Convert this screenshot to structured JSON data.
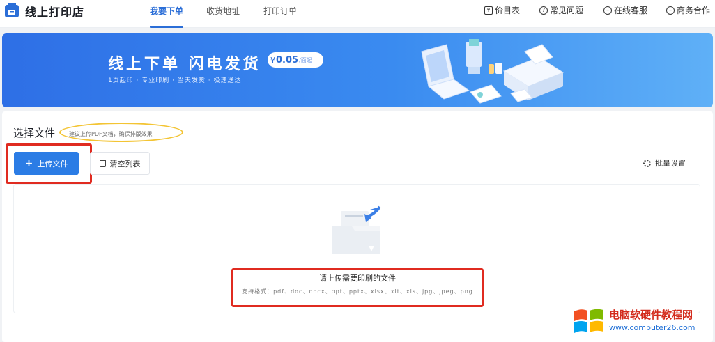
{
  "app": {
    "name": "线上打印店"
  },
  "nav": {
    "tabs": [
      {
        "label": "我要下单",
        "active": true
      },
      {
        "label": "收货地址",
        "active": false
      },
      {
        "label": "打印订单",
        "active": false
      }
    ],
    "right_links": [
      {
        "icon": "price-list-icon",
        "label": "价目表"
      },
      {
        "icon": "help-circle-icon",
        "label": "常见问题"
      },
      {
        "icon": "chat-icon",
        "label": "在线客服"
      },
      {
        "icon": "business-icon",
        "label": "商务合作"
      }
    ]
  },
  "banner": {
    "title": "线上下单  闪电发货",
    "price_symbol": "¥",
    "price_value": "0.05",
    "price_unit": "/面起",
    "subtitle": "1页起印 · 专业印刷 · 当天发货 · 极速送达"
  },
  "upload": {
    "section_title": "选择文件",
    "hint": "建议上传PDF文档，确保排版效果",
    "upload_button": "上传文件",
    "clear_button": "清空列表",
    "batch_settings": "批量设置",
    "dropzone_title": "请上传需要印刷的文件",
    "dropzone_formats": "支持格式：pdf、doc、docx、ppt、pptx、xlsx、xlt、xls、jpg、jpeg、png"
  },
  "watermark": {
    "title": "电脑软硬件教程网",
    "url": "www.computer26.com"
  },
  "colors": {
    "primary": "#2b7ce5",
    "highlight_red": "#e02b20",
    "highlight_yellow": "#f3c433"
  }
}
